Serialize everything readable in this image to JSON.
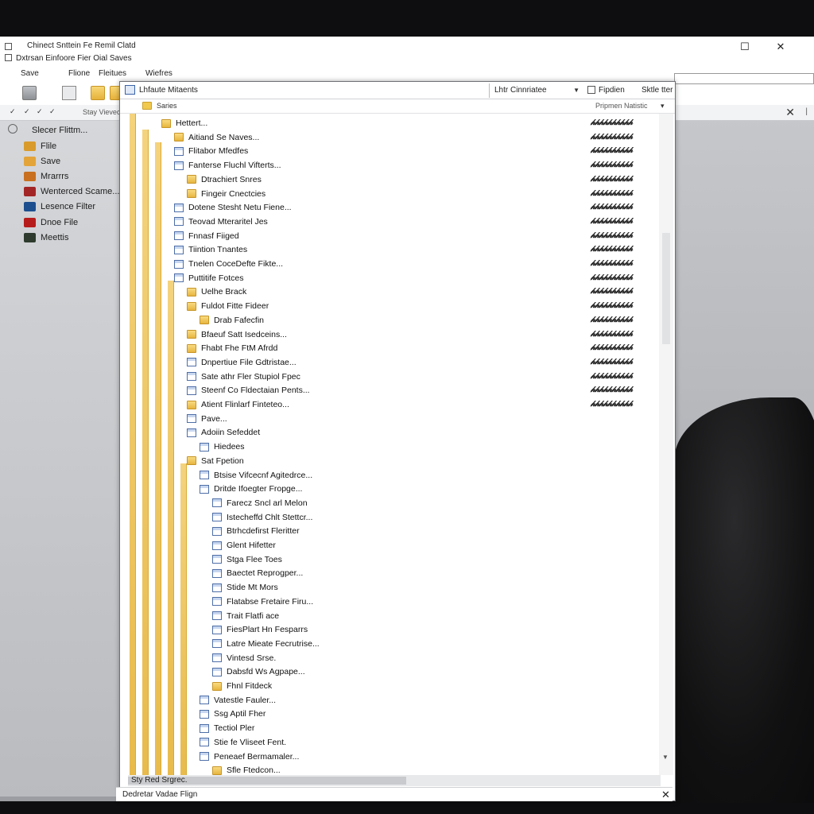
{
  "window": {
    "title_line1": "Chinect Snttein Fe Remil Clatd",
    "title_line2": "Dxtrsan Einfoore Fier Oial Saves",
    "maximize_glyph": "☐",
    "close_glyph": "✕"
  },
  "menu": [
    "Save",
    "Flione",
    "Fleitues",
    "Wiefres"
  ],
  "addressbar": {
    "nav_glyphs": [
      "✓",
      "✓",
      "✓",
      "✓"
    ],
    "path_text": "Stay Vievecch",
    "close_glyph": "✕",
    "sep_glyph": "|"
  },
  "sidebar": {
    "header": "Slecer Flittm...",
    "items": [
      {
        "label": "Flile",
        "color": "#d99b2b"
      },
      {
        "label": "Save",
        "color": "#e3a43a"
      },
      {
        "label": "Mrarrrs",
        "color": "#c8701f"
      },
      {
        "label": "Wenterced Scame...",
        "color": "#a32626"
      },
      {
        "label": "Lesence Filter",
        "color": "#1d4f8f"
      },
      {
        "label": "Dnoe File",
        "color": "#b71c1c"
      },
      {
        "label": "Meettis",
        "color": "#2e3b2e"
      }
    ]
  },
  "dialog": {
    "title": "Lhfaute Mitaents",
    "select_value": "Lhtr Cinnriatee",
    "select_arrow": "▼",
    "header_a": "Fipdien",
    "header_b": "Sktle tter",
    "sub_label": "Saries",
    "sub_right": "Pripmen   Natistic",
    "sub_arrow": "▾",
    "scroll_mark": "↰",
    "vscroll_down": "▼"
  },
  "tree": {
    "hash_value": "𝒽𝒽𝒽𝒽𝒽𝒽𝒽𝒽𝒽𝒽",
    "rows": [
      {
        "label": "Hettert...",
        "icon": "folder",
        "indent": 0,
        "hash": true
      },
      {
        "label": "Aitiand Se Naves...",
        "icon": "folder",
        "indent": 1,
        "hash": true
      },
      {
        "label": "Flitabor Mfedfes",
        "icon": "doc",
        "indent": 1,
        "hash": true
      },
      {
        "label": "Fanterse Fluchl Vifterts...",
        "icon": "doc",
        "indent": 1,
        "hash": true
      },
      {
        "label": "Dtrachiert Snres",
        "icon": "folder",
        "indent": 2,
        "hash": true
      },
      {
        "label": "Fingeir Cnectcies",
        "icon": "folder",
        "indent": 2,
        "hash": true
      },
      {
        "label": "Dotene Stesht Netu Fiene...",
        "icon": "doc",
        "indent": 1,
        "hash": true
      },
      {
        "label": "Teovad Mteraritel Jes",
        "icon": "doc",
        "indent": 1,
        "hash": true
      },
      {
        "label": "Fnnasf Fiiged",
        "icon": "doc",
        "indent": 1,
        "hash": true
      },
      {
        "label": "Tiintion Tnantes",
        "icon": "doc",
        "indent": 1,
        "hash": true
      },
      {
        "label": "Tnelen CoceDefte Fikte...",
        "icon": "doc",
        "indent": 1,
        "hash": true
      },
      {
        "label": "Puttitife Fotces",
        "icon": "doc",
        "indent": 1,
        "hash": true
      },
      {
        "label": "Uelhe Brack",
        "icon": "folder",
        "indent": 2,
        "hash": true
      },
      {
        "label": "Fuldot Fitte Fideer",
        "icon": "folder",
        "indent": 2,
        "hash": true
      },
      {
        "label": "Drab Fafecfin",
        "icon": "folder",
        "indent": 3,
        "hash": true
      },
      {
        "label": "Bfaeuf Satt Isedceins...",
        "icon": "folder",
        "indent": 2,
        "hash": true
      },
      {
        "label": "Fhabt Fhe FtM Afrdd",
        "icon": "folder",
        "indent": 2,
        "hash": true
      },
      {
        "label": "Dnpertiue File Gdtristae...",
        "icon": "doc",
        "indent": 2,
        "hash": true
      },
      {
        "label": "Sate athr Fler Stupiol Fpec",
        "icon": "doc",
        "indent": 2,
        "hash": true
      },
      {
        "label": "Steenf Co Fldectaian Pents...",
        "icon": "doc",
        "indent": 2,
        "hash": true
      },
      {
        "label": "Atient Flinlarf Finteteo...",
        "icon": "folder",
        "indent": 2,
        "hash": true
      },
      {
        "label": "Pave...",
        "icon": "doc",
        "indent": 2,
        "hash": false
      },
      {
        "label": "Adoiin Sefeddet",
        "icon": "doc",
        "indent": 2,
        "hash": false
      },
      {
        "label": "Hiedees",
        "icon": "doc",
        "indent": 3,
        "hash": false
      },
      {
        "label": "Sat Fpetion",
        "icon": "folder",
        "indent": 2,
        "hash": false
      },
      {
        "label": "Btsise Vifcecnf Agitedrce...",
        "icon": "doc",
        "indent": 3,
        "hash": false
      },
      {
        "label": "Dritde Ifoegter Fropge...",
        "icon": "doc",
        "indent": 3,
        "hash": false
      },
      {
        "label": "Farecz Sncl arl Melon",
        "icon": "doc",
        "indent": 4,
        "hash": false
      },
      {
        "label": "Istecheffd Chlt Stettcr...",
        "icon": "doc",
        "indent": 4,
        "hash": false
      },
      {
        "label": "Btrhcdefirst Fleritter",
        "icon": "doc",
        "indent": 4,
        "hash": false
      },
      {
        "label": "Glent Hifetter",
        "icon": "doc",
        "indent": 4,
        "hash": false
      },
      {
        "label": "Stga Flee Toes",
        "icon": "doc",
        "indent": 4,
        "hash": false
      },
      {
        "label": "Baectet Reprogper...",
        "icon": "doc",
        "indent": 4,
        "hash": false
      },
      {
        "label": "Stide Mt Mors",
        "icon": "doc",
        "indent": 4,
        "hash": false
      },
      {
        "label": "Flatabse Fretaire Firu...",
        "icon": "doc",
        "indent": 4,
        "hash": false
      },
      {
        "label": "Trait Flatfi ace",
        "icon": "doc",
        "indent": 4,
        "hash": false
      },
      {
        "label": "FiesPlart Hn Fesparrs",
        "icon": "doc",
        "indent": 4,
        "hash": false
      },
      {
        "label": "Latre Mieate Fecrutrise...",
        "icon": "doc",
        "indent": 4,
        "hash": false
      },
      {
        "label": "Vintesd Srse.",
        "icon": "doc",
        "indent": 4,
        "hash": false
      },
      {
        "label": "Dabsfd Ws Agpape...",
        "icon": "doc",
        "indent": 4,
        "hash": false
      },
      {
        "label": "Fhnl Fitdeck",
        "icon": "folder",
        "indent": 4,
        "hash": false
      },
      {
        "label": "Vatestle Fauler...",
        "icon": "doc",
        "indent": 3,
        "hash": false
      },
      {
        "label": "Ssg Aptil Fher",
        "icon": "doc",
        "indent": 3,
        "hash": false
      },
      {
        "label": "Tectiol Pler",
        "icon": "doc",
        "indent": 3,
        "hash": false
      },
      {
        "label": "Stie fe Vliseet Fent.",
        "icon": "doc",
        "indent": 3,
        "hash": false
      },
      {
        "label": "Peneaef Bermamaler...",
        "icon": "doc",
        "indent": 3,
        "hash": false
      },
      {
        "label": "Sfle Ftedcon...",
        "icon": "folder",
        "indent": 4,
        "hash": false
      }
    ]
  },
  "status": {
    "left": "Sty Red Srgrec.",
    "bottom": "Dedretar Vadae Flign",
    "bottom_close": "✕"
  }
}
